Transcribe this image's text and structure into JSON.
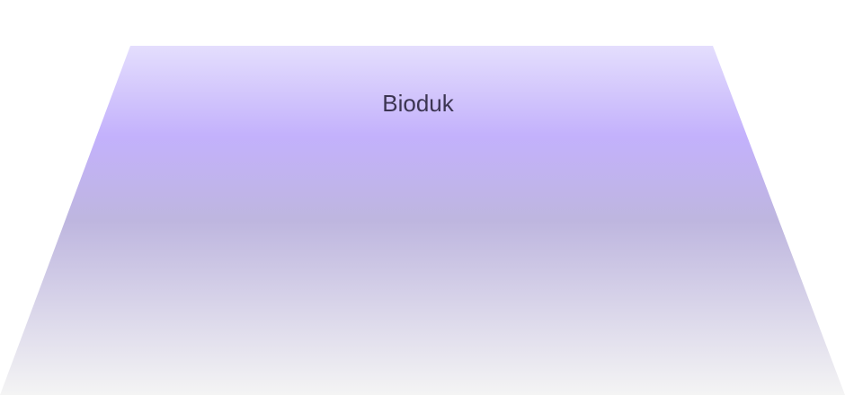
{
  "funnel": {
    "stage_label": "Bioduk",
    "label_color": "#3c3552",
    "gradient": {
      "top": "#e4defd",
      "band": "#c3b1fc",
      "middle": "#beb6df",
      "bottom": "#f4f4f4"
    }
  }
}
